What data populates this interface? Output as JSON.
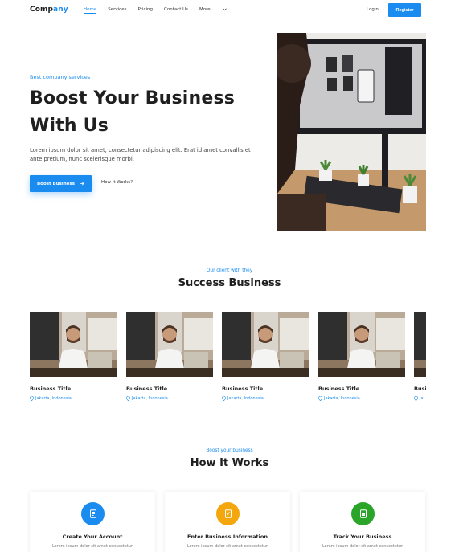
{
  "nav": {
    "logo_part1": "Comp",
    "logo_part2": "any",
    "links": [
      "Home",
      "Services",
      "Pricing",
      "Contact Us",
      "More"
    ],
    "login": "Login",
    "register": "Register"
  },
  "hero": {
    "kicker": "Best company services",
    "title": "Boost Your Business With Us",
    "text": "Lorem ipsum dolor sit amet, consectetur adipiscing elit. Erat id amet convallis et ante pretium, nunc scelerisque morbi.",
    "primary_button": "Boost Business",
    "secondary_button": "How It Works?"
  },
  "success": {
    "kicker": "Our client with they",
    "title": "Success Business",
    "cards": [
      {
        "title": "Business Title",
        "location": "Jakarta, Indonesia"
      },
      {
        "title": "Business Title",
        "location": "Jakarta, Indonesia"
      },
      {
        "title": "Business Title",
        "location": "Jakarta, Indonesia"
      },
      {
        "title": "Business Title",
        "location": "Jakarta, Indonesia"
      },
      {
        "title": "Busi",
        "location": "Ja"
      }
    ]
  },
  "how": {
    "kicker": "Boost your business",
    "title": "How It Works",
    "steps": [
      {
        "title": "Create Your Account",
        "text": "Lorem ipsum dolor sit amet consectetur",
        "color": "#1a8cf0"
      },
      {
        "title": "Enter Business Information",
        "text": "Lorem ipsum dolor sit amet consectetur",
        "color": "#f4a60d"
      },
      {
        "title": "Track Your Business",
        "text": "Lorem ipsum dolor sit amet consectetur",
        "color": "#2aa52a"
      }
    ]
  },
  "colors": {
    "accent": "#1a8cf0"
  }
}
